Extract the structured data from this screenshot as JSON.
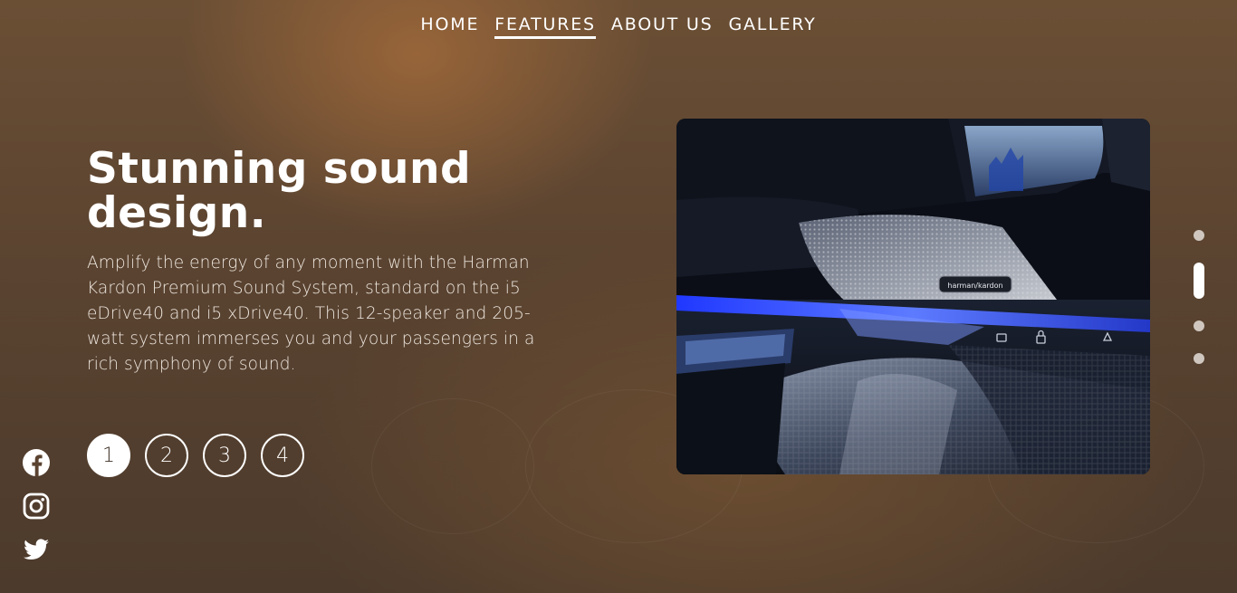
{
  "nav": {
    "items": [
      {
        "label": "HOME"
      },
      {
        "label": "FEATURES",
        "active": true
      },
      {
        "label": "ABOUT US"
      },
      {
        "label": "GALLERY"
      }
    ]
  },
  "hero": {
    "title": "Stunning sound design.",
    "body": "Amplify the energy of any moment with the Harman Kardon Premium Sound System, standard on the i5 eDrive40 and i5 xDrive40. This 12-speaker and 205-watt system immerses you and your passengers in a rich symphony of sound."
  },
  "pager": {
    "pages": [
      "1",
      "2",
      "3",
      "4"
    ],
    "active_index": 0
  },
  "social": {
    "icons": [
      "facebook-icon",
      "instagram-icon",
      "twitter-icon"
    ]
  },
  "image": {
    "badge_text": "harman/kardon"
  },
  "side_dots": {
    "count": 4,
    "active_index": 1
  },
  "colors": {
    "accent": "#ffffff",
    "background": "#5a4330",
    "ambient_light": "#3b5bff"
  }
}
